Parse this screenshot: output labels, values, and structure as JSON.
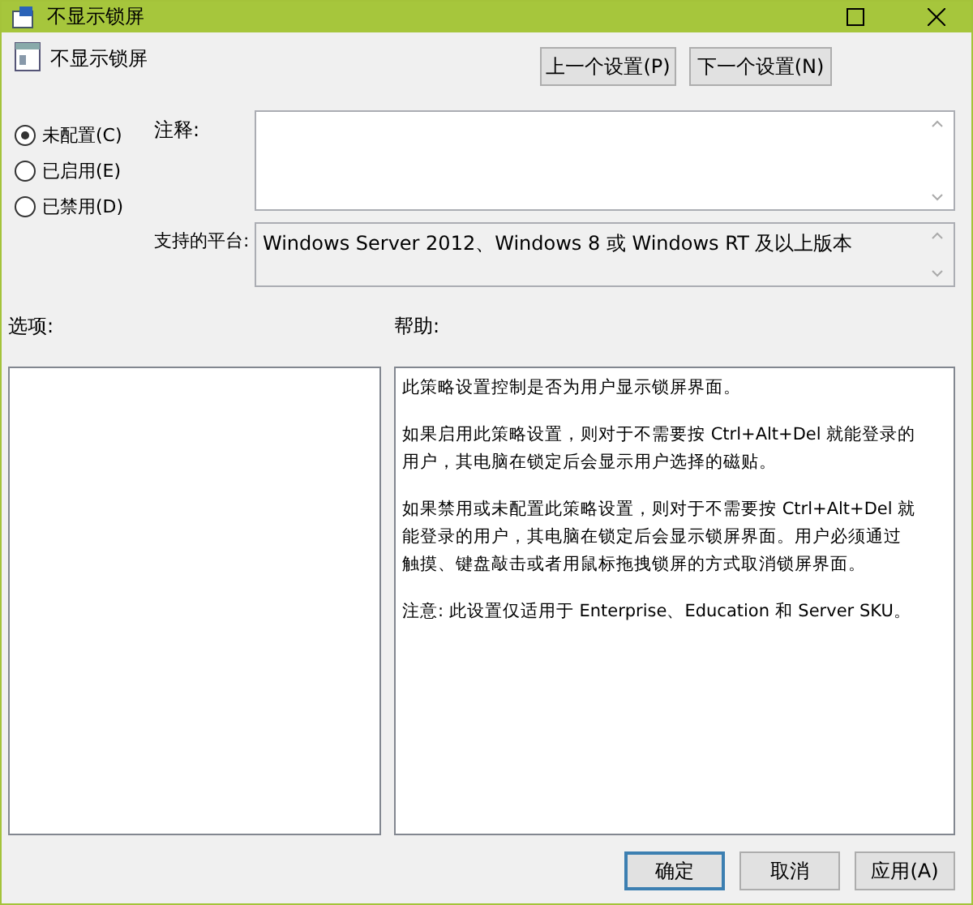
{
  "window": {
    "title": "不显示锁屏"
  },
  "policy": {
    "name": "不显示锁屏"
  },
  "nav_buttons": [
    "上一个设置(P)",
    "下一个设置(N)"
  ],
  "radios": [
    {
      "label": "未配置(C)",
      "selected": true
    },
    {
      "label": "已启用(E)",
      "selected": false
    },
    {
      "label": "已禁用(D)",
      "selected": false
    }
  ],
  "comment": {
    "label": "注释:"
  },
  "platform": {
    "label": "支持的平台:",
    "value": "Windows Server 2012、Windows 8 或 Windows RT 及以上版本"
  },
  "options": {
    "label": "选项:"
  },
  "help": {
    "label": "帮助:",
    "paragraphs": [
      "此策略设置控制是否为用户显示锁屏界面。",
      "如果启用此策略设置，则对于不需要按 Ctrl+Alt+Del 就能登录的用户，其电脑在锁定后会显示用户选择的磁贴。",
      "如果禁用或未配置此策略设置，则对于不需要按 Ctrl+Alt+Del 就能登录的用户，其电脑在锁定后会显示锁屏界面。用户必须通过触摸、键盘敲击或者用鼠标拖拽锁屏的方式取消锁屏界面。",
      "注意: 此设置仅适用于 Enterprise、Education 和 Server SKU。"
    ]
  },
  "footer_buttons": [
    {
      "label": "确定",
      "selected": true
    },
    {
      "label": "取消",
      "selected": false
    },
    {
      "label": "应用(A)",
      "selected": false
    }
  ]
}
